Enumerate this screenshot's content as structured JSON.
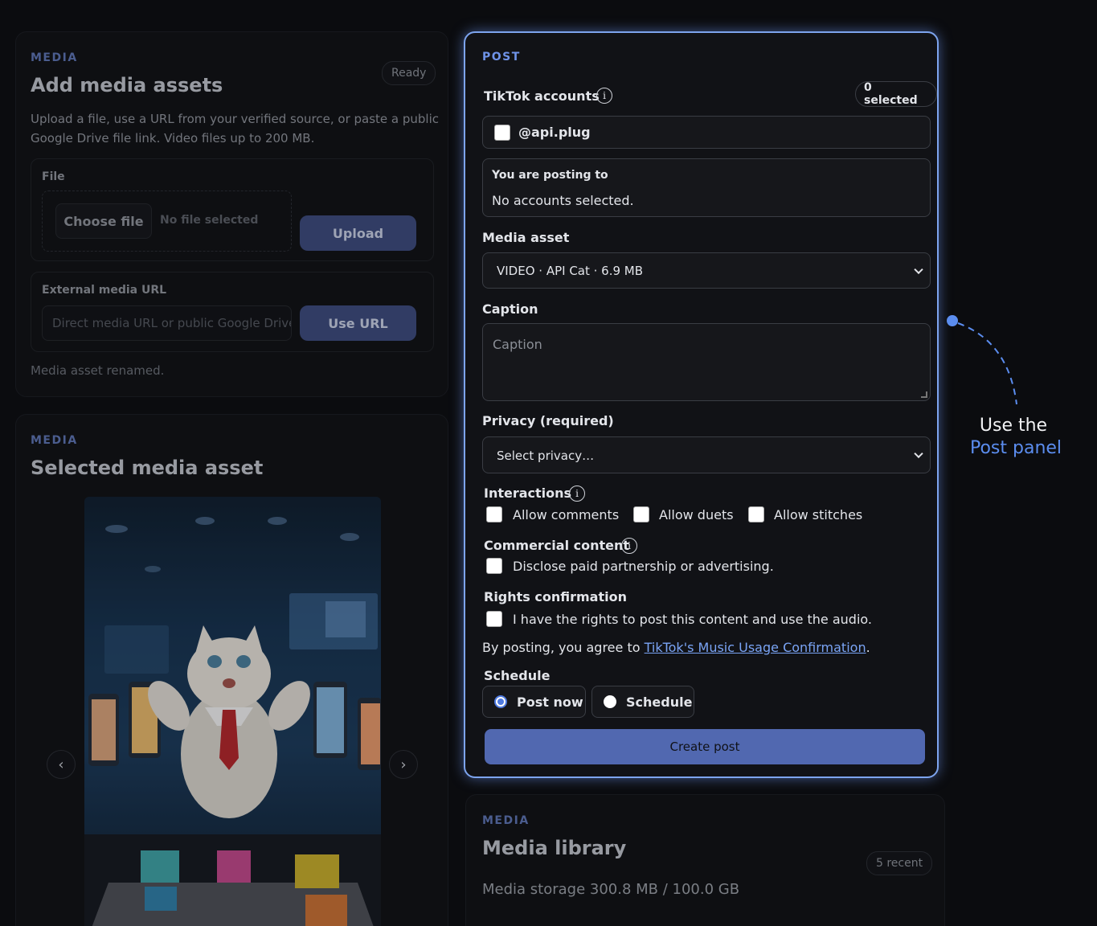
{
  "add_media": {
    "eyebrow": "MEDIA",
    "title": "Add media assets",
    "status": "Ready",
    "description": "Upload a file, use a URL from your verified source, or paste a public Google Drive file link. Video files up to 200 MB.",
    "file_label": "File",
    "choose_file": "Choose file",
    "no_file": "No file selected",
    "upload_button": "Upload",
    "url_label": "External media URL",
    "url_placeholder": "Direct media URL or public Google Drive l",
    "use_url_button": "Use URL",
    "message": "Media asset renamed."
  },
  "selected_media": {
    "eyebrow": "MEDIA",
    "title": "Selected media asset",
    "prev": "‹",
    "next": "›"
  },
  "post": {
    "eyebrow": "POST",
    "accounts_label": "TikTok accounts",
    "selected_count": "0 selected",
    "account_handle": "@api.plug",
    "posting_to_label": "You are posting to",
    "posting_to_value": "No accounts selected.",
    "media_asset_label": "Media asset",
    "media_asset_value": "VIDEO · API Cat · 6.9 MB",
    "caption_label": "Caption",
    "caption_placeholder": "Caption",
    "privacy_label": "Privacy (required)",
    "privacy_value": "Select privacy…",
    "interactions_label": "Interactions",
    "allow_comments": "Allow comments",
    "allow_duets": "Allow duets",
    "allow_stitches": "Allow stitches",
    "commercial_label": "Commercial content",
    "commercial_option": "Disclose paid partnership or advertising.",
    "rights_label": "Rights confirmation",
    "rights_option": "I have the rights to post this content and use the audio.",
    "agree_prefix": "By posting, you agree to ",
    "agree_link": "TikTok's Music Usage Confirmation",
    "agree_suffix": ".",
    "schedule_label": "Schedule",
    "post_now": "Post now",
    "schedule_option": "Schedule",
    "create_button": "Create post",
    "info_glyph": "i"
  },
  "library": {
    "eyebrow": "MEDIA",
    "title": "Media library",
    "recent": "5 recent",
    "storage": "Media storage 300.8 MB / 100.0 GB"
  },
  "callout": {
    "line1": "Use the",
    "line2": "Post panel",
    "accent": "#5b8def"
  }
}
